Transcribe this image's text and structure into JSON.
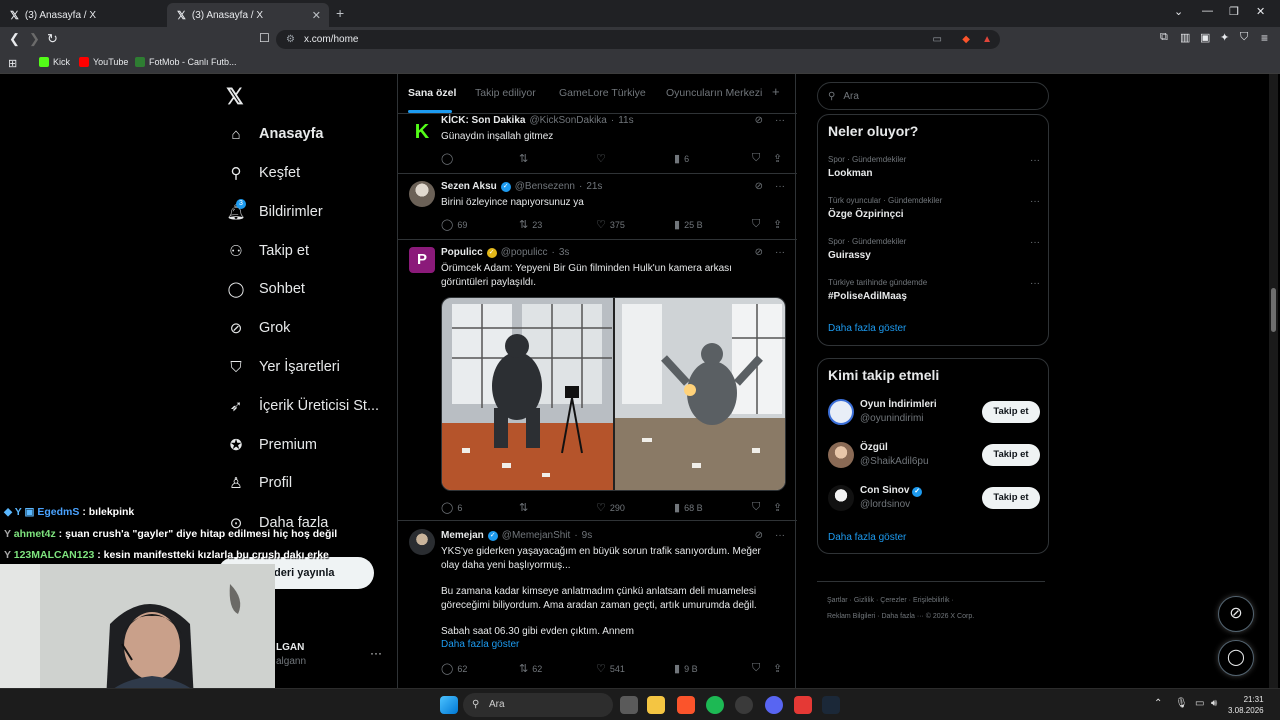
{
  "browser": {
    "tabs": [
      {
        "title": "(3) Anasayfa / X",
        "active": false
      },
      {
        "title": "(3) Anasayfa / X",
        "active": true
      }
    ],
    "url": "x.com/home",
    "bookmarks": [
      "Kick",
      "YouTube",
      "FotMob - Canlı Futb..."
    ]
  },
  "sidebar": {
    "items": [
      {
        "label": "Anasayfa",
        "icon": "home-icon"
      },
      {
        "label": "Keşfet",
        "icon": "search-icon"
      },
      {
        "label": "Bildirimler",
        "icon": "bell-icon",
        "badge": "3"
      },
      {
        "label": "Takip et",
        "icon": "add-person-icon"
      },
      {
        "label": "Sohbet",
        "icon": "chat-icon"
      },
      {
        "label": "Grok",
        "icon": "grok-icon"
      },
      {
        "label": "Yer İşaretleri",
        "icon": "bookmark-icon"
      },
      {
        "label": "İçerik Üreticisi St...",
        "icon": "rocket-icon"
      },
      {
        "label": "Premium",
        "icon": "verified-icon"
      },
      {
        "label": "Profil",
        "icon": "person-icon"
      },
      {
        "label": "Daha fazla",
        "icon": "more-circle-icon"
      }
    ],
    "post_button": "deri yayınla",
    "account_name": "LGAN",
    "account_handle": "algann"
  },
  "feed": {
    "tabs": [
      "Sana özel",
      "Takip ediliyor",
      "GameLore Türkiye",
      "Oyuncuların Merkezi"
    ],
    "add_tab": "+",
    "posts": [
      {
        "name": "KİCK: Son Dakika",
        "handle": "@KickSonDakika",
        "time": "11s",
        "text": "Günaydın inşallah gitmez",
        "replies": "",
        "reposts": "",
        "likes": "",
        "views": "6"
      },
      {
        "name": "Sezen Aksu",
        "handle": "@Bensezenn",
        "time": "21s",
        "text": "Birini özleyince napıyorsunuz ya",
        "replies": "69",
        "reposts": "23",
        "likes": "375",
        "views": "25 B"
      },
      {
        "name": "Populicc",
        "handle": "@populicc",
        "time": "3s",
        "text": "Örümcek Adam: Yepyeni Bir Gün filminden Hulk'un kamera arkası görüntüleri paylaşıldı.",
        "replies": "6",
        "reposts": "",
        "likes": "290",
        "views": "68 B"
      },
      {
        "name": "Memejan",
        "handle": "@MemejanShit",
        "time": "9s",
        "text": "YKS'ye giderken yaşayacağım en büyük sorun trafik sanıyordum. Meğer olay daha yeni başlıyormuş...",
        "text2": "Bu zamana kadar kimseye anlatmadım çünkü anlatsam deli muamelesi göreceğimi biliyordum. Ama aradan zaman geçti, artık umurumda değil.",
        "text3": "Sabah saat 06.30 gibi evden çıktım. Annem",
        "more": "Daha fazla göster",
        "replies": "62",
        "reposts": "62",
        "likes": "541",
        "views": "9 B"
      }
    ]
  },
  "right": {
    "search_placeholder": "Ara",
    "trends_title": "Neler oluyor?",
    "trends": [
      {
        "meta": "Spor · Gündemdekiler",
        "name": "Lookman"
      },
      {
        "meta": "Türk oyuncular · Gündemdekiler",
        "name": "Özge Özpirinçci"
      },
      {
        "meta": "Spor · Gündemdekiler",
        "name": "Guirassy"
      },
      {
        "meta": "Türkiye tarihinde gündemde",
        "name": "#PoliseAdilMaaş"
      }
    ],
    "show_more": "Daha fazla göster",
    "who_title": "Kimi takip etmeli",
    "who": [
      {
        "name": "Oyun İndirimleri",
        "handle": "@oyunindirimi",
        "button": "Takip et"
      },
      {
        "name": "Özgül",
        "handle": "@ShaikAdil6pu",
        "button": "Takip et"
      },
      {
        "name": "Con Sinov",
        "handle": "@lordsinov",
        "button": "Takip et"
      }
    ],
    "who_more": "Daha fazla göster",
    "footer1": "Şartlar  ·  Gizlilik  ·  Çerezler  ·  Erişilebilirlik  ·",
    "footer2": "Reklam Bilgileri  ·  Daha fazla  ···  © 2026 X Corp."
  },
  "chat": [
    {
      "user": "EgedmS",
      "msg": "bılekpink",
      "color": "#4aa3ff"
    },
    {
      "user": "ahmet4z",
      "msg": "şuan crush'a \"gayler\" diye hitap edilmesi hiç hoş değil",
      "color": "#7ee37e"
    },
    {
      "user": "123MALCAN123",
      "msg": "kesin manifestteki kızlarla bu crush dakı erke",
      "color": "#7ee37e"
    }
  ],
  "taskbar": {
    "search": "Ara",
    "time": "21:31",
    "date": "3.08.2026"
  },
  "colors": {
    "accent": "#1d9bf0",
    "background": "#000000",
    "border": "#2f3336",
    "muted": "#71767b"
  }
}
